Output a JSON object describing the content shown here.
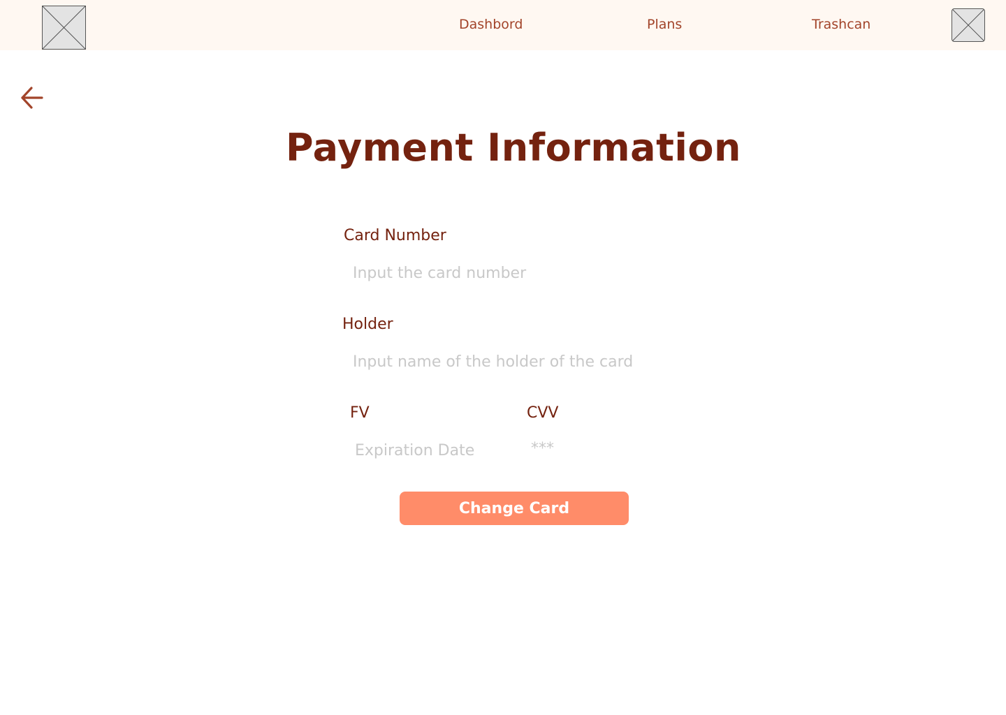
{
  "navbar": {
    "logo_icon": "image-placeholder-icon",
    "links": {
      "dashboard": "Dashbord",
      "plans": "Plans",
      "trashcan": "Trashcan"
    },
    "avatar_icon": "image-placeholder-icon"
  },
  "back_icon": "arrow-left-icon",
  "page": {
    "title": "Payment Information"
  },
  "form": {
    "card_number": {
      "label": "Card Number",
      "placeholder": "Input the card number",
      "value": ""
    },
    "holder": {
      "label": "Holder",
      "placeholder": "Input name of the holder of the card",
      "value": ""
    },
    "fv": {
      "label": "FV",
      "placeholder": "Expiration Date",
      "value": ""
    },
    "cvv": {
      "label": "CVV",
      "placeholder": "***",
      "value": ""
    },
    "submit_label": "Change Card"
  },
  "colors": {
    "navbar_background": "#fff8f2",
    "nav_link": "#a2442a",
    "title": "#74220f",
    "label": "#74220f",
    "placeholder": "#c8c8c8",
    "button_background": "#ff8c69",
    "button_text": "#ffffff"
  }
}
